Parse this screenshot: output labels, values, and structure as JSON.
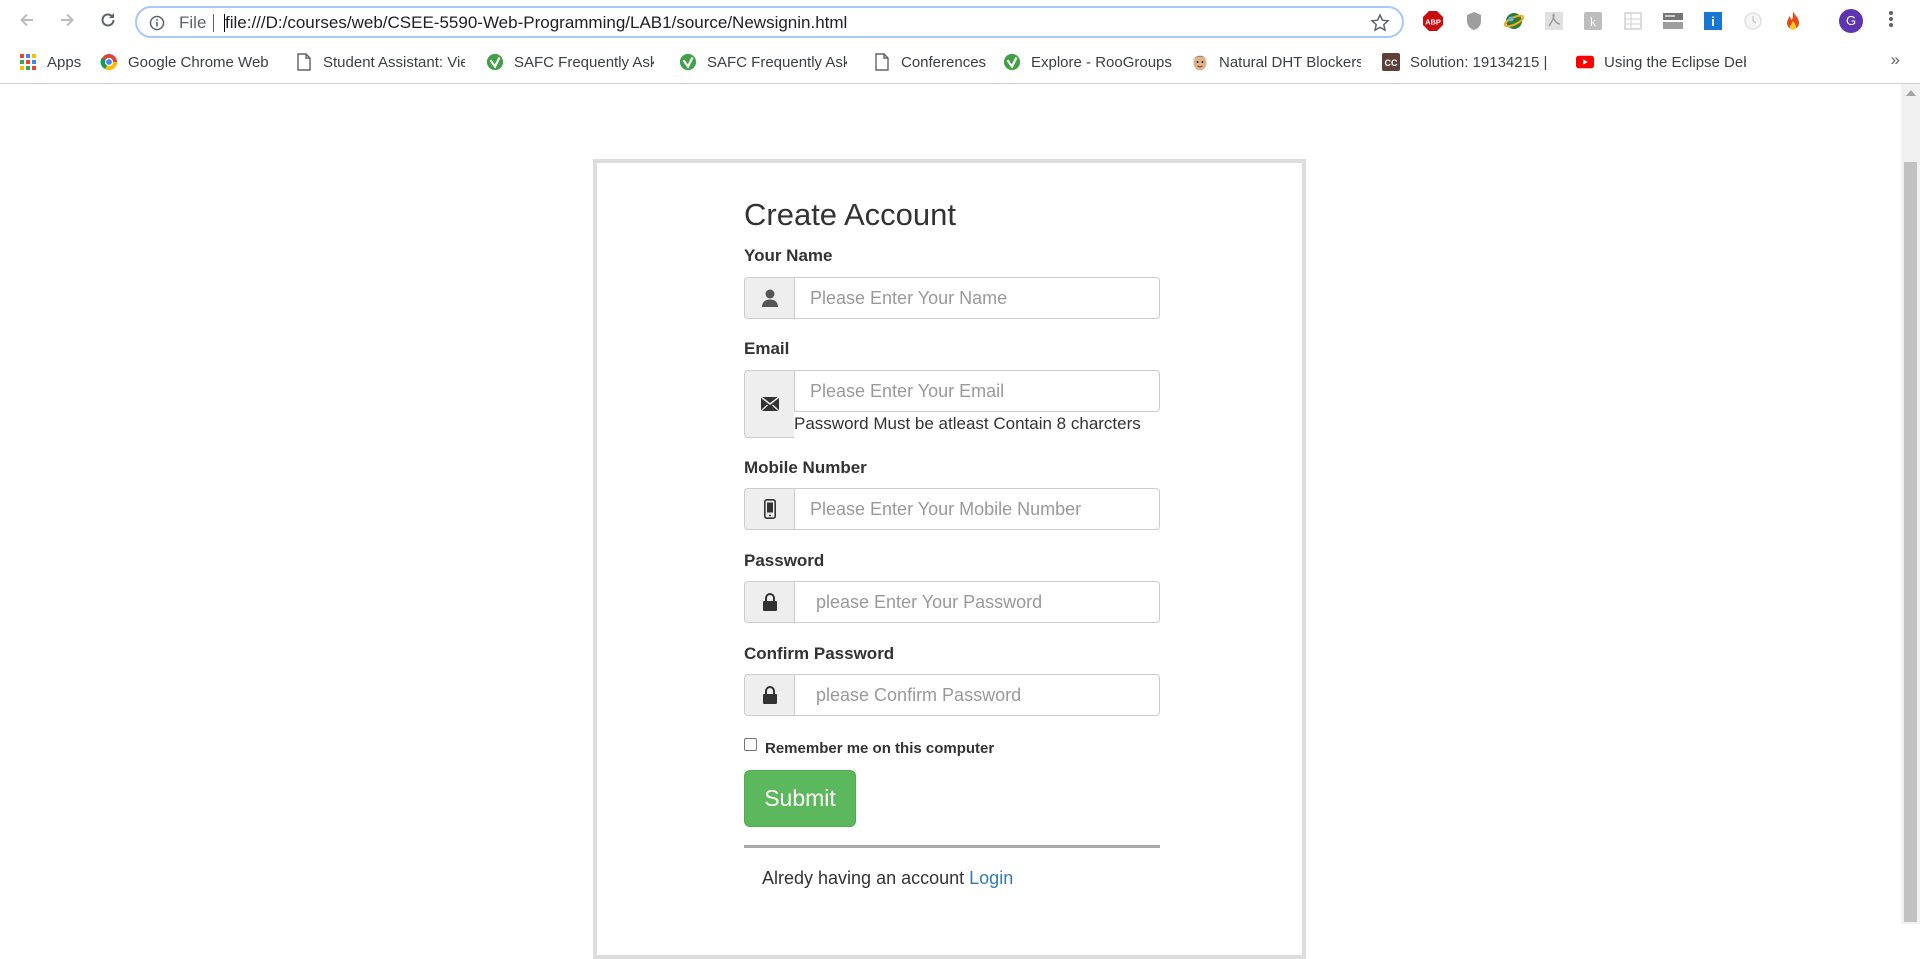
{
  "browser": {
    "file_label": "File",
    "url": "file:///D:/courses/web/CSEE-5590-Web-Programming/LAB1/source/Newsignin.html",
    "profile_initial": "G",
    "bookmarks": [
      {
        "label": "Apps",
        "icon": "apps-grid-icon"
      },
      {
        "label": "Google Chrome Web",
        "icon": "chrome-icon"
      },
      {
        "label": "Student Assistant: Vie",
        "icon": "page-icon"
      },
      {
        "label": "SAFC Frequently Aske",
        "icon": "safc-check-icon"
      },
      {
        "label": "SAFC Frequently Aske",
        "icon": "safc-check-icon"
      },
      {
        "label": "Conferences",
        "icon": "page-icon"
      },
      {
        "label": "Explore - RooGroups",
        "icon": "safc-check-icon"
      },
      {
        "label": "Natural DHT Blockers",
        "icon": "face-icon"
      },
      {
        "label": "Solution: 19134215 |",
        "icon": "cc-icon"
      },
      {
        "label": "Using the Eclipse Deb",
        "icon": "youtube-icon"
      }
    ],
    "more": "»"
  },
  "form": {
    "title": "Create Account",
    "name_label": "Your Name",
    "name_placeholder": "Please Enter Your Name",
    "email_label": "Email",
    "email_placeholder": "Please Enter Your Email",
    "email_hint": "Password Must be atleast Contain 8 charcters",
    "mobile_label": "Mobile Number",
    "mobile_placeholder": "Please Enter Your Mobile Number",
    "password_label": "Password",
    "password_placeholder": "please Enter Your Password",
    "confirm_label": "Confirm Password",
    "confirm_placeholder": "please Confirm Password",
    "remember_label": "Remember me on this computer",
    "submit_label": "Submit",
    "footer_text": "Alredy having an account",
    "login_link": "Login"
  },
  "colors": {
    "submit_bg": "#5cb85c",
    "link": "#337ab7",
    "omnibox_border": "#a8c7fa"
  }
}
